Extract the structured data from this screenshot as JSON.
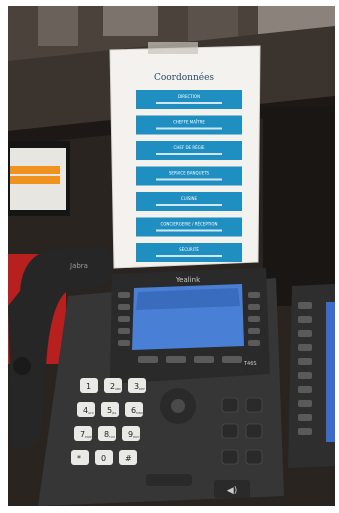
{
  "sign": {
    "title": "Coordonnées",
    "rows": [
      {
        "label": "DIRECTION",
        "sub": ""
      },
      {
        "label": "CHEFFE MAÎTRE",
        "sub": ""
      },
      {
        "label": "CHEF DE RÉGIE",
        "sub": ""
      },
      {
        "label": "SERVICE BANQUETS",
        "sub": ""
      },
      {
        "label": "CUISINE",
        "sub": ""
      },
      {
        "label": "CONCIERGERIE / RÉCEPTION",
        "sub": ""
      },
      {
        "label": "SÉCURITÉ",
        "sub": ""
      }
    ]
  },
  "phone": {
    "brand": "Yealink",
    "model": "T46S",
    "handset_logo": "Jabra",
    "keypad": [
      "1",
      "2",
      "3",
      "4",
      "5",
      "6",
      "7",
      "8",
      "9",
      "*",
      "0",
      "#"
    ],
    "keypad_sub": [
      "",
      "ABC",
      "DEF",
      "GHI",
      "JKL",
      "MNO",
      "PQRS",
      "TUV",
      "WXYZ",
      "",
      "",
      ""
    ]
  },
  "colors": {
    "sign_band": "#1f8fc1",
    "screen": "#4a7fd6",
    "monitor_accent": "#f0921f",
    "phone_body": "#3a3a3a"
  }
}
